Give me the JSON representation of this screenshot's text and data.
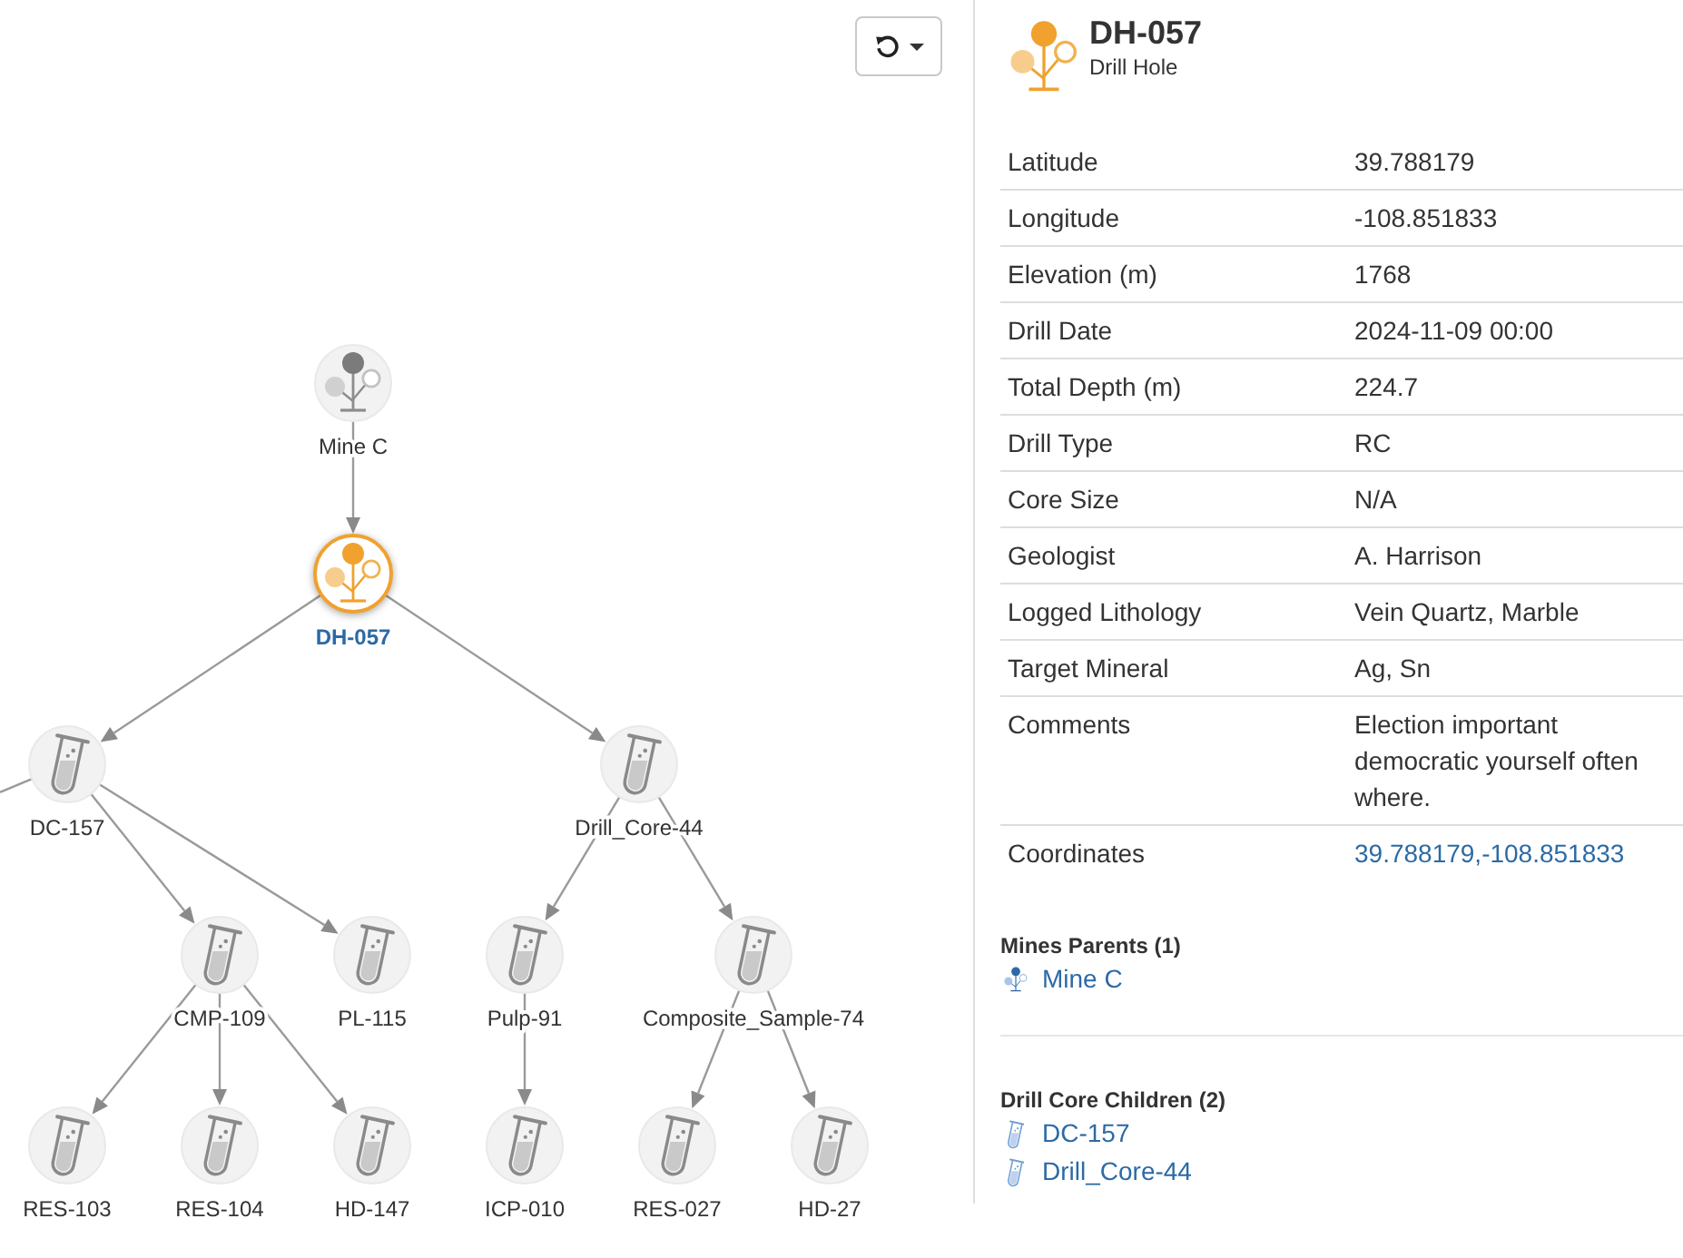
{
  "graph": {
    "nodes": [
      {
        "label": "Mine C",
        "kind": "location",
        "selected": false,
        "children": [
          {
            "label": "DH-057",
            "kind": "location",
            "selected": true,
            "children": [
              {
                "label": "DC-157",
                "kind": "sample",
                "selected": false,
                "edge_out_of_view": true,
                "children": [
                  {
                    "label": "CMP-109",
                    "kind": "sample",
                    "selected": false,
                    "children": [
                      {
                        "label": "RES-103",
                        "kind": "sample",
                        "selected": false
                      },
                      {
                        "label": "RES-104",
                        "kind": "sample",
                        "selected": false
                      },
                      {
                        "label": "HD-147",
                        "kind": "sample",
                        "selected": false
                      }
                    ]
                  },
                  {
                    "label": "PL-115",
                    "kind": "sample",
                    "selected": false
                  }
                ]
              },
              {
                "label": "Drill_Core-44",
                "kind": "sample",
                "selected": false,
                "children": [
                  {
                    "label": "Pulp-91",
                    "kind": "sample",
                    "selected": false,
                    "children": [
                      {
                        "label": "ICP-010",
                        "kind": "sample",
                        "selected": false
                      }
                    ]
                  },
                  {
                    "label": "Composite_Sample-74",
                    "kind": "sample",
                    "selected": false,
                    "children": [
                      {
                        "label": "RES-027",
                        "kind": "sample",
                        "selected": false
                      },
                      {
                        "label": "HD-27",
                        "kind": "sample",
                        "selected": false
                      }
                    ]
                  }
                ]
              }
            ]
          }
        ]
      }
    ]
  },
  "details": {
    "kind": "location",
    "title": "DH-057",
    "subtitle": "Drill Hole",
    "rows": [
      {
        "label": "Latitude",
        "value": "39.788179",
        "kind": "text"
      },
      {
        "label": "Longitude",
        "value": "-108.851833",
        "kind": "text"
      },
      {
        "label": "Elevation (m)",
        "value": "1768",
        "kind": "text"
      },
      {
        "label": "Drill Date",
        "value": "2024-11-09 00:00",
        "kind": "text"
      },
      {
        "label": "Total Depth (m)",
        "value": "224.7",
        "kind": "text"
      },
      {
        "label": "Drill Type",
        "value": "RC",
        "kind": "text"
      },
      {
        "label": "Core Size",
        "value": "N/A",
        "kind": "text"
      },
      {
        "label": "Geologist",
        "value": "A. Harrison",
        "kind": "text"
      },
      {
        "label": "Logged Lithology",
        "value": "Vein Quartz, Marble",
        "kind": "text"
      },
      {
        "label": "Target Mineral",
        "value": "Ag, Sn",
        "kind": "text"
      },
      {
        "label": "Comments",
        "value": "Election important democratic yourself often where.",
        "kind": "text"
      },
      {
        "label": "Coordinates",
        "value": "39.788179,-108.851833",
        "kind": "link"
      }
    ]
  },
  "relations": [
    {
      "title": "Mines Parents (1)",
      "items": [
        {
          "label": "Mine C",
          "kind": "location"
        }
      ]
    },
    {
      "title": "Drill Core Children (2)",
      "items": [
        {
          "label": "DC-157",
          "kind": "sample"
        },
        {
          "label": "Drill_Core-44",
          "kind": "sample"
        }
      ]
    }
  ]
}
